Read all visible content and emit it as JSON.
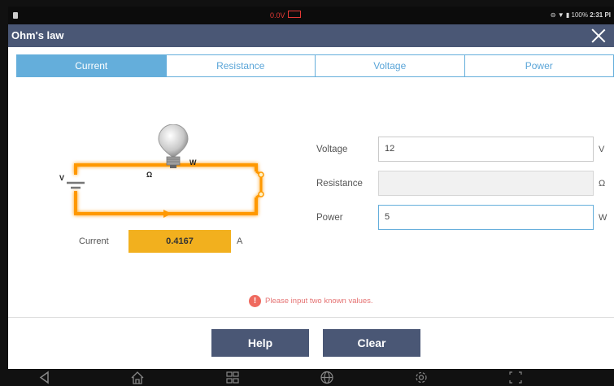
{
  "status": {
    "voltage": "0.0V",
    "battery": "100%",
    "time": "2:31 PI"
  },
  "title": "Ohm's law",
  "tabs": [
    {
      "label": "Current",
      "active": true
    },
    {
      "label": "Resistance",
      "active": false
    },
    {
      "label": "Voltage",
      "active": false
    },
    {
      "label": "Power",
      "active": false
    }
  ],
  "circuit": {
    "v_label": "V",
    "ohm_label": "Ω",
    "w_label": "W"
  },
  "result": {
    "label": "Current",
    "value": "0.4167",
    "unit": "A"
  },
  "fields": [
    {
      "label": "Voltage",
      "value": "12",
      "unit": "V"
    },
    {
      "label": "Resistance",
      "value": "",
      "unit": "Ω"
    },
    {
      "label": "Power",
      "value": "5",
      "unit": "W"
    }
  ],
  "message": "Please input two known values.",
  "buttons": {
    "help": "Help",
    "clear": "Clear"
  },
  "colors": {
    "accent": "#64aedb",
    "header": "#4a5775",
    "result": "#f2b01e",
    "wire": "#ff9800",
    "error": "#e57373"
  },
  "nav_icons": [
    "back-icon",
    "home-icon",
    "apps-icon",
    "browser-icon",
    "settings-icon",
    "screenshot-icon"
  ]
}
